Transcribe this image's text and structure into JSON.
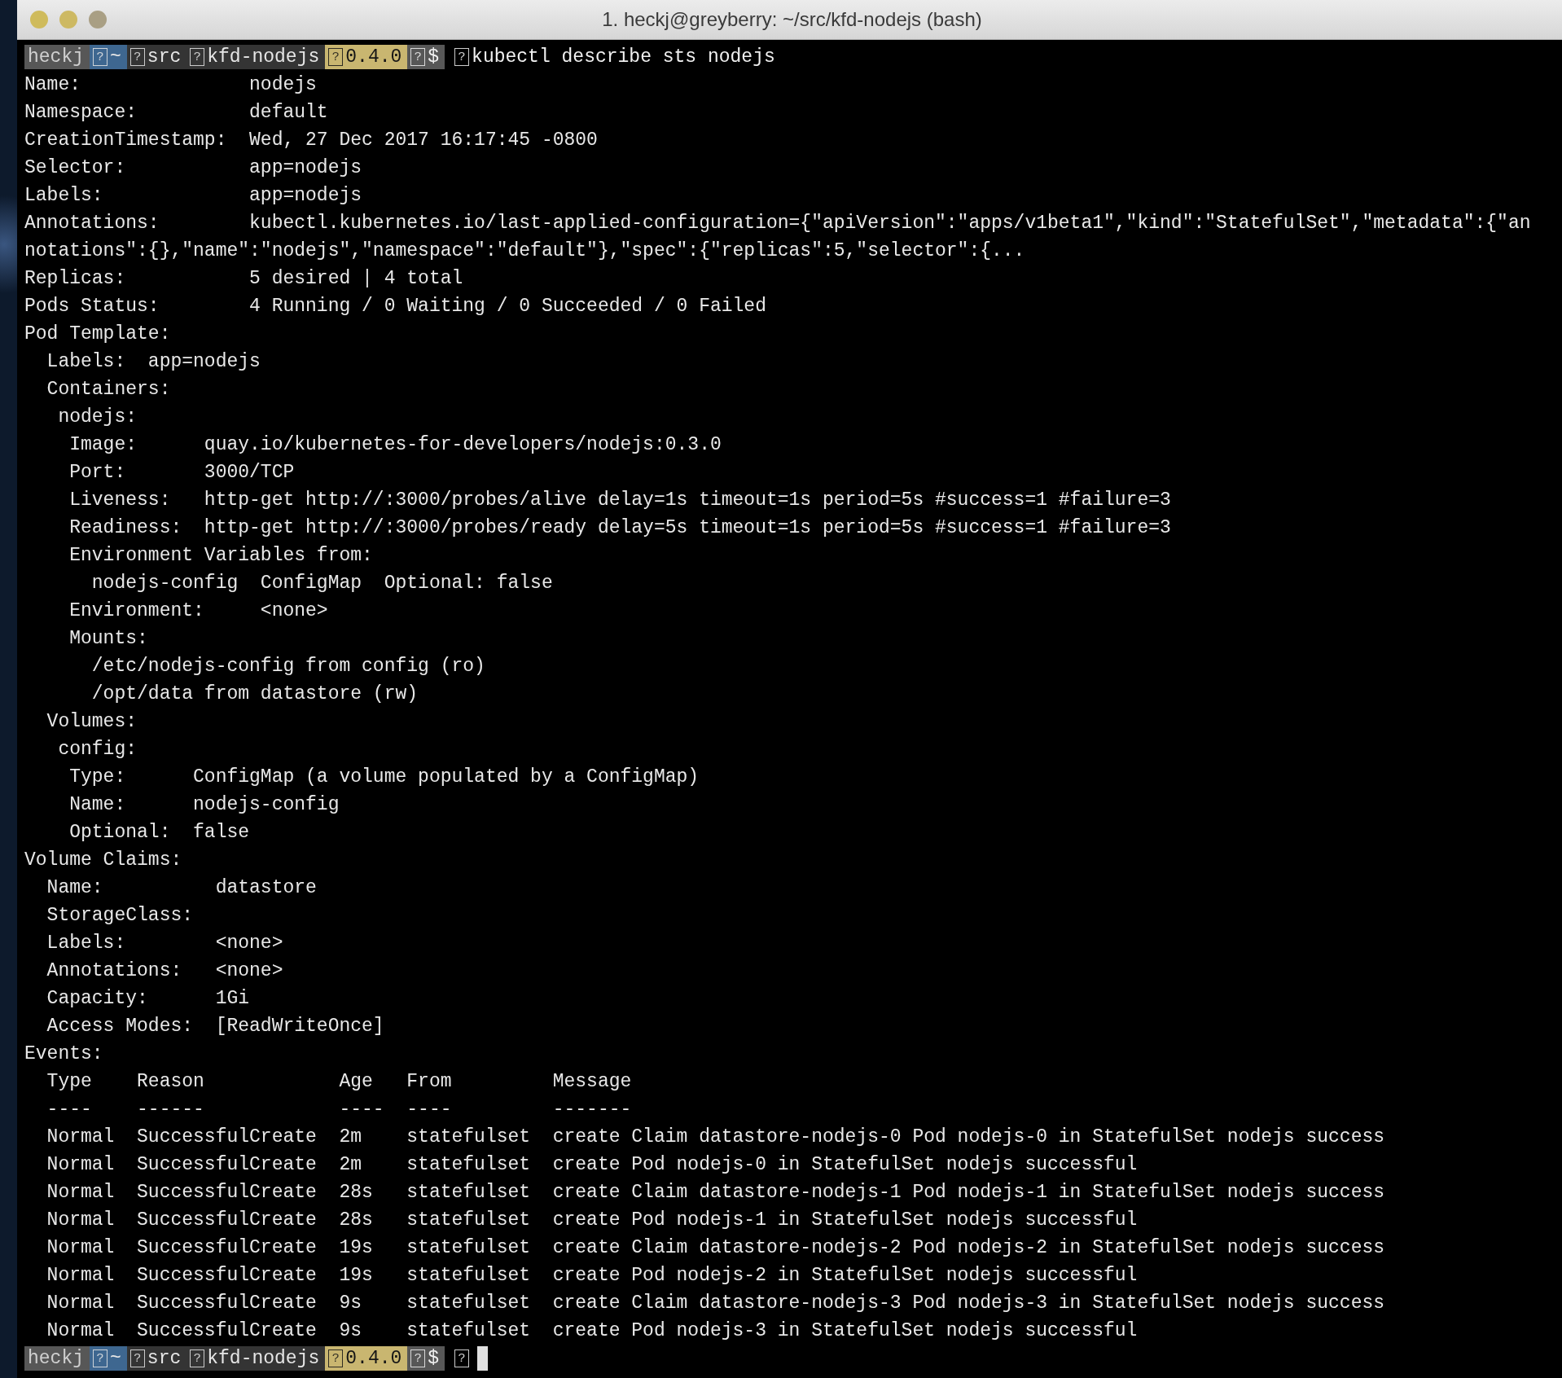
{
  "window": {
    "title": "1. heckj@greyberry: ~/src/kfd-nodejs (bash)"
  },
  "terminal": {
    "blocks": [
      {
        "kind": "prompt",
        "cursor": false,
        "segments": [
          {
            "kind": "user",
            "text": "heckj"
          },
          {
            "kind": "home",
            "glyph": "?",
            "text": "~"
          },
          {
            "kind": "dir",
            "glyph": "?",
            "text": "src"
          },
          {
            "kind": "dir",
            "glyph": "?",
            "text": "kfd-nodejs"
          },
          {
            "kind": "version",
            "glyph": "?",
            "text": "0.4.0"
          },
          {
            "kind": "symbol",
            "glyph": "?",
            "text": "$"
          },
          {
            "kind": "command",
            "glyph": "?",
            "text": "kubectl describe sts nodejs"
          }
        ]
      },
      {
        "kind": "output",
        "lines": [
          "Name:               nodejs",
          "Namespace:          default",
          "CreationTimestamp:  Wed, 27 Dec 2017 16:17:45 -0800",
          "Selector:           app=nodejs",
          "Labels:             app=nodejs",
          "Annotations:        kubectl.kubernetes.io/last-applied-configuration={\"apiVersion\":\"apps/v1beta1\",\"kind\":\"StatefulSet\",\"metadata\":{\"an",
          "notations\":{},\"name\":\"nodejs\",\"namespace\":\"default\"},\"spec\":{\"replicas\":5,\"selector\":{...",
          "Replicas:           5 desired | 4 total",
          "Pods Status:        4 Running / 0 Waiting / 0 Succeeded / 0 Failed",
          "Pod Template:",
          "  Labels:  app=nodejs",
          "  Containers:",
          "   nodejs:",
          "    Image:      quay.io/kubernetes-for-developers/nodejs:0.3.0",
          "    Port:       3000/TCP",
          "    Liveness:   http-get http://:3000/probes/alive delay=1s timeout=1s period=5s #success=1 #failure=3",
          "    Readiness:  http-get http://:3000/probes/ready delay=5s timeout=1s period=5s #success=1 #failure=3",
          "    Environment Variables from:",
          "      nodejs-config  ConfigMap  Optional: false",
          "    Environment:     <none>",
          "    Mounts:",
          "      /etc/nodejs-config from config (ro)",
          "      /opt/data from datastore (rw)",
          "  Volumes:",
          "   config:",
          "    Type:      ConfigMap (a volume populated by a ConfigMap)",
          "    Name:      nodejs-config",
          "    Optional:  false",
          "Volume Claims:",
          "  Name:          datastore",
          "  StorageClass:",
          "  Labels:        <none>",
          "  Annotations:   <none>",
          "  Capacity:      1Gi",
          "  Access Modes:  [ReadWriteOnce]",
          "Events:",
          "  Type    Reason            Age   From         Message",
          "  ----    ------            ----  ----         -------",
          "  Normal  SuccessfulCreate  2m    statefulset  create Claim datastore-nodejs-0 Pod nodejs-0 in StatefulSet nodejs success",
          "  Normal  SuccessfulCreate  2m    statefulset  create Pod nodejs-0 in StatefulSet nodejs successful",
          "  Normal  SuccessfulCreate  28s   statefulset  create Claim datastore-nodejs-1 Pod nodejs-1 in StatefulSet nodejs success",
          "  Normal  SuccessfulCreate  28s   statefulset  create Pod nodejs-1 in StatefulSet nodejs successful",
          "  Normal  SuccessfulCreate  19s   statefulset  create Claim datastore-nodejs-2 Pod nodejs-2 in StatefulSet nodejs success",
          "  Normal  SuccessfulCreate  19s   statefulset  create Pod nodejs-2 in StatefulSet nodejs successful",
          "  Normal  SuccessfulCreate  9s    statefulset  create Claim datastore-nodejs-3 Pod nodejs-3 in StatefulSet nodejs success",
          "  Normal  SuccessfulCreate  9s    statefulset  create Pod nodejs-3 in StatefulSet nodejs successful"
        ]
      },
      {
        "kind": "prompt",
        "cursor": true,
        "segments": [
          {
            "kind": "user",
            "text": "heckj"
          },
          {
            "kind": "home",
            "glyph": "?",
            "text": "~"
          },
          {
            "kind": "dir",
            "glyph": "?",
            "text": "src"
          },
          {
            "kind": "dir",
            "glyph": "?",
            "text": "kfd-nodejs"
          },
          {
            "kind": "version",
            "glyph": "?",
            "text": "0.4.0"
          },
          {
            "kind": "symbol",
            "glyph": "?",
            "text": "$"
          },
          {
            "kind": "command",
            "glyph": "?"
          }
        ]
      }
    ]
  }
}
